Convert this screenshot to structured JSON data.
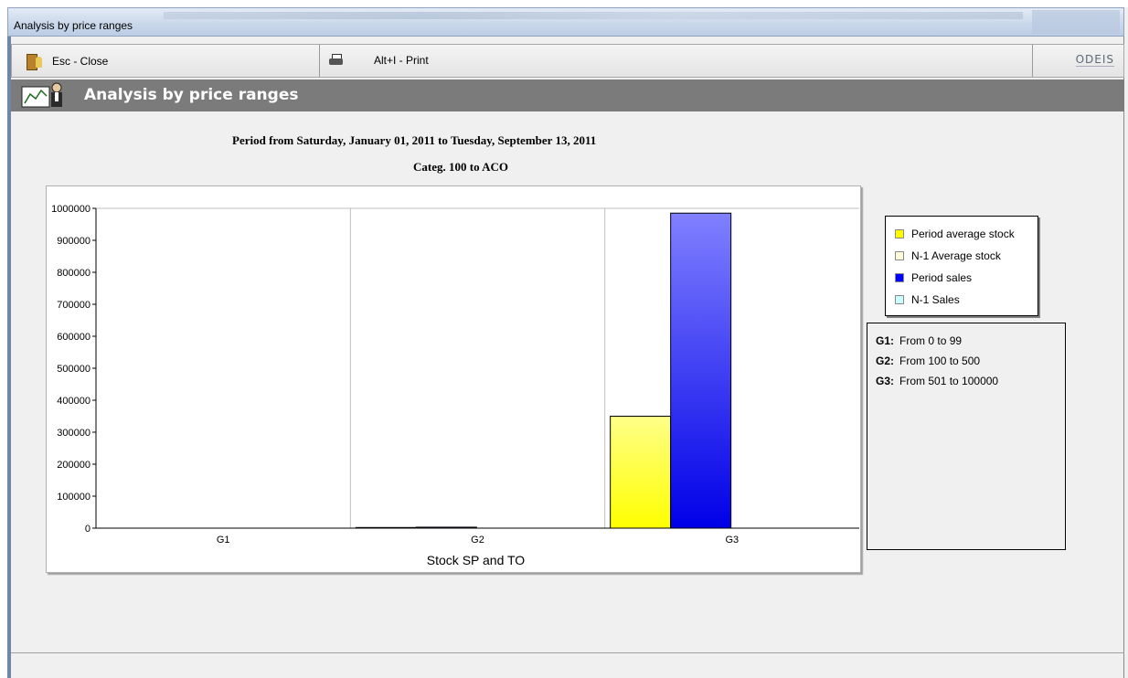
{
  "window": {
    "title": "Analysis by price ranges"
  },
  "toolbar": {
    "close_label": "Esc - Close",
    "print_label": "Alt+I - Print",
    "logo_text": "ODEIS"
  },
  "header": {
    "title": "Analysis by price ranges"
  },
  "report": {
    "period": "Period from Saturday, January 01, 2011  to Tuesday, September 13, 2011",
    "category": "Categ. 100  to ACO"
  },
  "chart_data": {
    "type": "bar",
    "categories": [
      "G1",
      "G2",
      "G3"
    ],
    "xlabel": "Stock SP and TO",
    "ylabel": "",
    "ylim": [
      0,
      1000000
    ],
    "yticks": [
      "0",
      "100000",
      "200000",
      "300000",
      "400000",
      "500000",
      "600000",
      "700000",
      "800000",
      "900000",
      "1000000"
    ],
    "grid": "vertical category separators",
    "legend_position": "right",
    "series": [
      {
        "name": "Period average stock",
        "color": "#ffff00",
        "values": [
          0,
          2000,
          350000
        ]
      },
      {
        "name": "N-1 Average stock",
        "color": "#ffffe0",
        "values": [
          0,
          0,
          0
        ]
      },
      {
        "name": "Period sales",
        "color": "#0000ff",
        "values": [
          0,
          3000,
          985000
        ]
      },
      {
        "name": "N-1 Sales",
        "color": "#ccffff",
        "values": [
          0,
          0,
          0
        ]
      }
    ]
  },
  "ranges": [
    {
      "code": "G1:",
      "text": "From 0  to 99"
    },
    {
      "code": "G2:",
      "text": "From 100  to 500"
    },
    {
      "code": "G3:",
      "text": "From 501  to 100000"
    }
  ]
}
